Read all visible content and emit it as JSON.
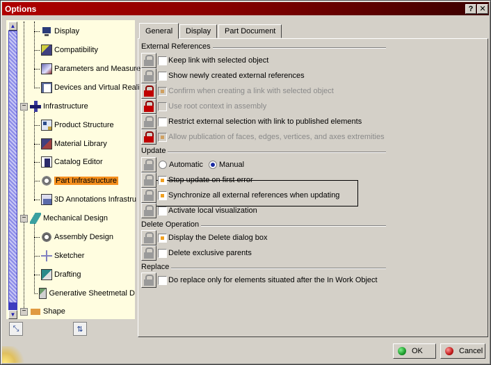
{
  "window": {
    "title": "Options"
  },
  "titlebar": {
    "help": "?",
    "close": "✕"
  },
  "tree": {
    "items": [
      {
        "label": "Display",
        "icon": "display-icon"
      },
      {
        "label": "Compatibility",
        "icon": "compatibility-icon"
      },
      {
        "label": "Parameters and Measure",
        "icon": "parameters-icon"
      },
      {
        "label": "Devices and Virtual Reali",
        "icon": "devices-icon"
      },
      {
        "label": "Infrastructure",
        "icon": "infrastructure-icon"
      },
      {
        "label": "Product Structure",
        "icon": "product-structure-icon"
      },
      {
        "label": "Material Library",
        "icon": "material-library-icon"
      },
      {
        "label": "Catalog Editor",
        "icon": "catalog-editor-icon"
      },
      {
        "label": "Part Infrastructure",
        "icon": "part-infrastructure-icon",
        "selected": true
      },
      {
        "label": "3D Annotations Infrastru",
        "icon": "annotations-icon"
      },
      {
        "label": "Mechanical Design",
        "icon": "mechanical-design-icon"
      },
      {
        "label": "Assembly Design",
        "icon": "assembly-design-icon"
      },
      {
        "label": "Sketcher",
        "icon": "sketcher-icon"
      },
      {
        "label": "Drafting",
        "icon": "drafting-icon"
      },
      {
        "label": "Generative Sheetmetal D",
        "icon": "sheetmetal-icon"
      },
      {
        "label": "Shape",
        "icon": "shape-icon"
      }
    ]
  },
  "tabs": [
    {
      "label": "General",
      "active": true
    },
    {
      "label": "Display",
      "active": false
    },
    {
      "label": "Part Document",
      "active": false
    }
  ],
  "groups": {
    "external_references": {
      "title": "External References",
      "options": [
        {
          "label": "Keep link with selected object",
          "checked": false,
          "enabled": true,
          "locked": false
        },
        {
          "label": "Show newly created external references",
          "checked": false,
          "enabled": true,
          "locked": false
        },
        {
          "label": "Confirm when creating a link with selected object",
          "checked": true,
          "enabled": false,
          "locked": true
        },
        {
          "label": "Use root context in assembly",
          "checked": false,
          "enabled": false,
          "locked": true
        },
        {
          "label": "Restrict external selection with link to published elements",
          "checked": false,
          "enabled": true,
          "locked": false
        },
        {
          "label": "Allow publication of faces, edges, vertices, and axes extremities",
          "checked": true,
          "enabled": false,
          "locked": true
        }
      ]
    },
    "update": {
      "title": "Update",
      "radio_automatic": "Automatic",
      "radio_manual": "Manual",
      "selected": "Manual",
      "options": [
        {
          "label": "Stop update on first error",
          "checked": true
        },
        {
          "label": "Synchronize all external references when updating",
          "checked": true
        },
        {
          "label": "Activate local visualization",
          "checked": false
        }
      ]
    },
    "delete_operation": {
      "title": "Delete Operation",
      "options": [
        {
          "label": "Display the Delete dialog box",
          "checked": true
        },
        {
          "label": "Delete exclusive parents",
          "checked": false
        }
      ]
    },
    "replace": {
      "title": "Replace",
      "options": [
        {
          "label": "Do replace only for elements situated after the In Work Object",
          "checked": false
        }
      ]
    }
  },
  "buttons": {
    "ok": "OK",
    "cancel": "Cancel",
    "ok_color": "#1a9a2a",
    "cancel_color": "#c01818"
  }
}
